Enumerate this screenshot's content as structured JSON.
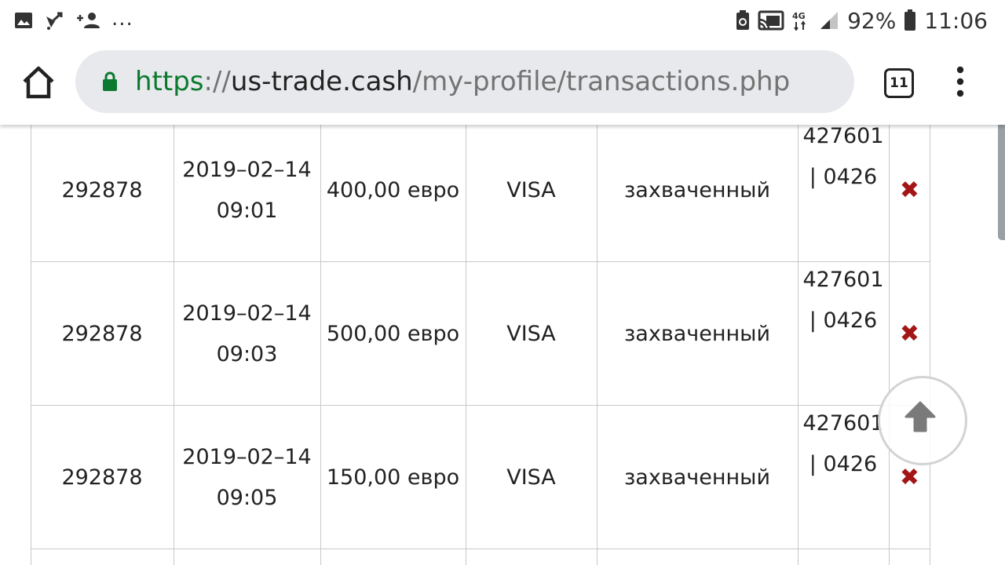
{
  "status_bar": {
    "left_icons": [
      "image-icon",
      "satellite-icon",
      "add-person-icon"
    ],
    "overflow": "...",
    "battery_percent": "92%",
    "time": "11:06",
    "network": "4G"
  },
  "browser": {
    "url_scheme": "https",
    "url_sep": "://",
    "url_host": "us-trade.cash",
    "url_path": "/my-profile/transactions.php",
    "tab_count": "11"
  },
  "transactions": [
    {
      "id": "292878",
      "date": "2019–02–14",
      "time": "09:01",
      "amount": "400,00 евро",
      "method": "VISA",
      "status": "захваченный",
      "card_a": "427601",
      "card_b": "| 0426"
    },
    {
      "id": "292878",
      "date": "2019–02–14",
      "time": "09:03",
      "amount": "500,00 евро",
      "method": "VISA",
      "status": "захваченный",
      "card_a": "427601",
      "card_b": "| 0426"
    },
    {
      "id": "292878",
      "date": "2019–02–14",
      "time": "09:05",
      "amount": "150,00 евро",
      "method": "VISA",
      "status": "захваченный",
      "card_a": "427601",
      "card_b": "| 0426"
    }
  ],
  "colors": {
    "accent_secure": "#0b7a2e",
    "delete": "#a31616",
    "urlbar_bg": "#e8e9ec"
  }
}
